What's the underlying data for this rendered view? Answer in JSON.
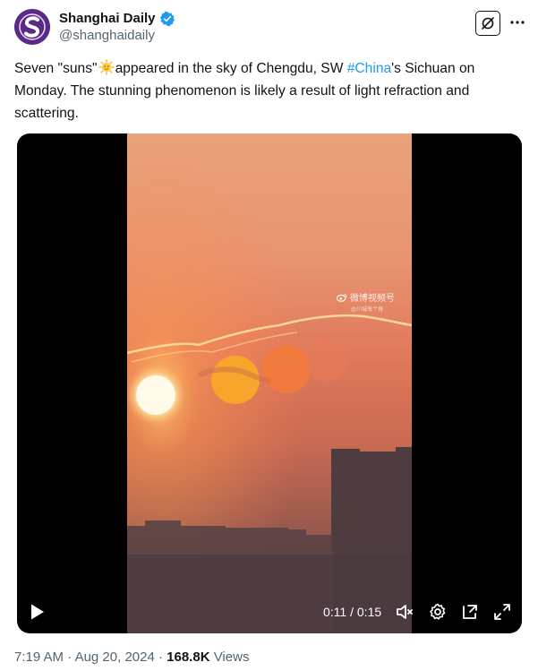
{
  "account": {
    "display_name": "Shanghai Daily",
    "handle": "@shanghaidaily",
    "avatar_letter": "S",
    "verified_color": "#1d9bf0"
  },
  "tweet": {
    "text_part1": "Seven \"suns\"",
    "text_part2": "appeared in the sky of Chengdu, SW ",
    "hashtag": "#China",
    "text_part3": "'s Sichuan on Monday. The stunning phenomenon is likely a result of light refraction and scattering.",
    "emoji": "sun-with-face"
  },
  "video": {
    "watermark_title": "微博视频号",
    "watermark_sub": "@川城每个角",
    "current_time": "0:11",
    "separator": "/",
    "duration": "0:15",
    "progress": 0.733
  },
  "meta": {
    "time": "7:19 AM",
    "dot": "·",
    "date": "Aug 20, 2024",
    "dot2": "·",
    "views": "168.8K",
    "views_label": "Views"
  },
  "colors": {
    "link": "#1d9bf0",
    "secondary_text": "#536471",
    "primary_text": "#0f1419",
    "avatar_bg": "#5b2a86"
  }
}
